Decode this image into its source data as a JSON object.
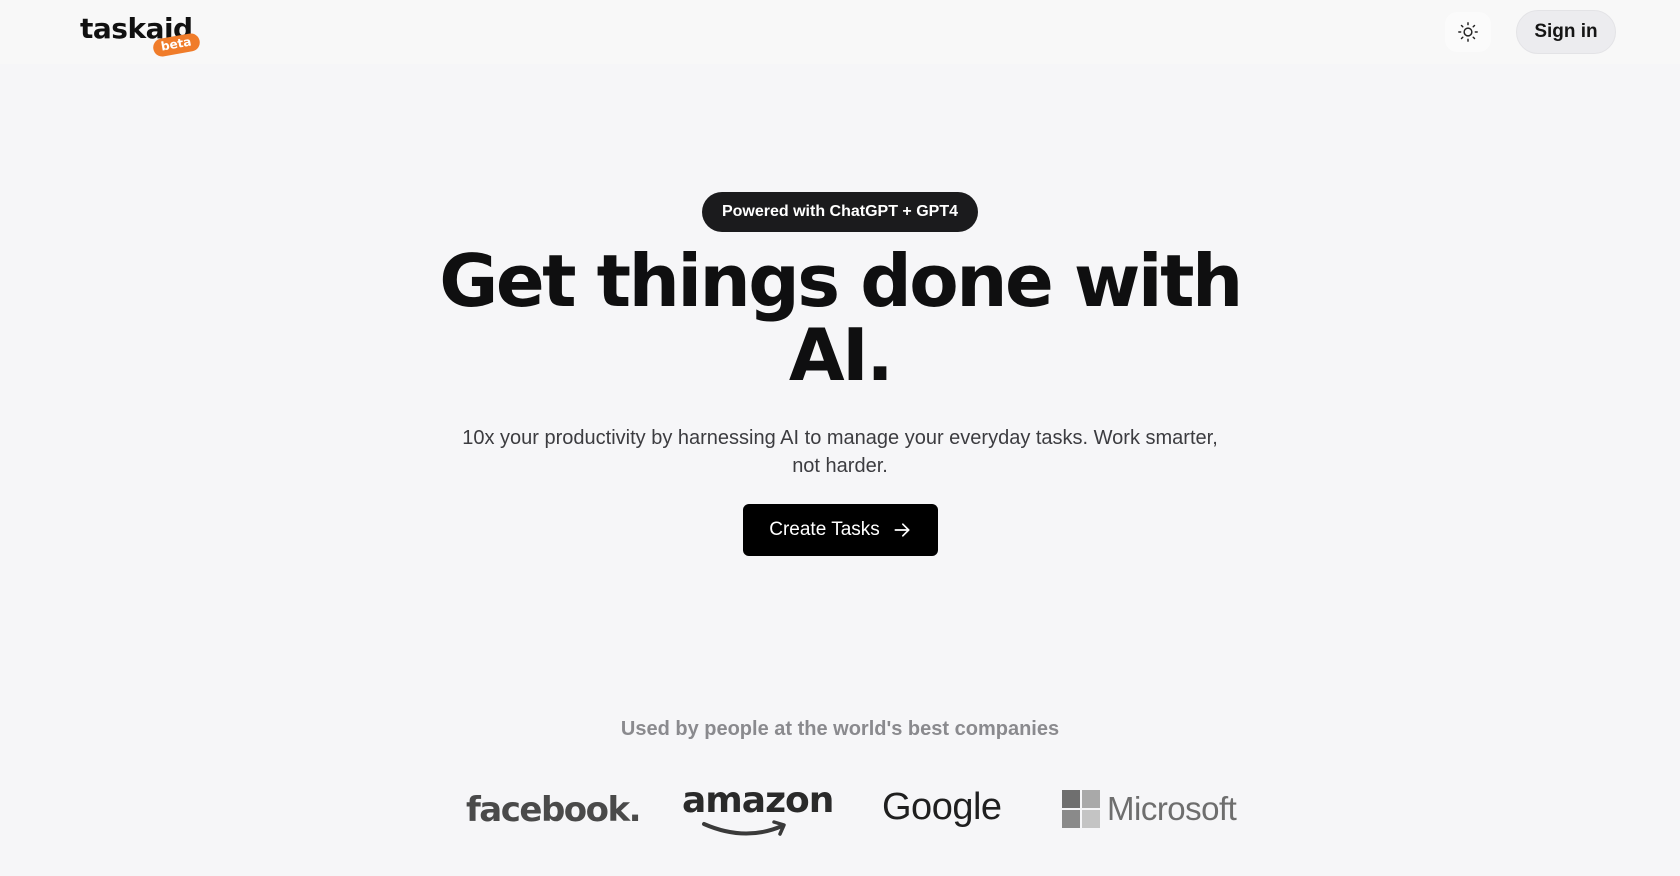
{
  "header": {
    "logo_text": "taskaid",
    "badge": "beta",
    "theme_icon": "sun-icon",
    "signin_label": "Sign in"
  },
  "hero": {
    "pill": "Powered with ChatGPT + GPT4",
    "headline_line1": "Get things done with",
    "headline_line2": "AI.",
    "subtext": "10x your productivity by harnessing AI to manage your everyday tasks. Work smarter, not harder.",
    "cta_label": "Create Tasks",
    "cta_icon": "arrow-right-icon"
  },
  "companies": {
    "heading": "Used by people at the world's best companies",
    "logos": [
      "facebook.",
      "amazon",
      "Google",
      "Microsoft"
    ]
  },
  "colors": {
    "background": "#f6f6f8",
    "badge": "#f07c2a",
    "cta": "#000000"
  }
}
